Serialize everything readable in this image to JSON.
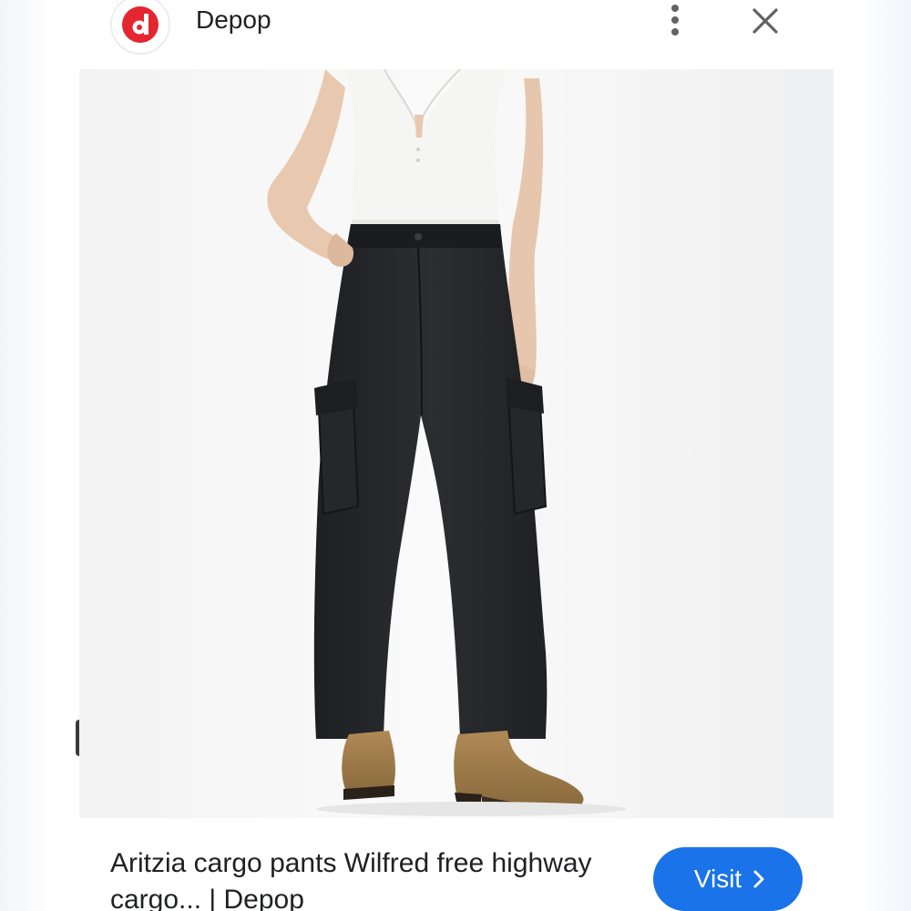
{
  "header": {
    "logo_letter": "d",
    "site_name": "Depop",
    "more_icon": "more-vert-icon",
    "close_icon": "close-icon"
  },
  "image": {
    "alt": "Person wearing black wide-leg cargo pants, white ribbed tank top and tan western boots"
  },
  "result": {
    "title": "Aritzia cargo pants Wilfred free highway cargo... | Depop",
    "visit_label": "Visit"
  },
  "colors": {
    "brand": "#e3262f",
    "accent": "#1a73e8",
    "text": "#202124"
  }
}
